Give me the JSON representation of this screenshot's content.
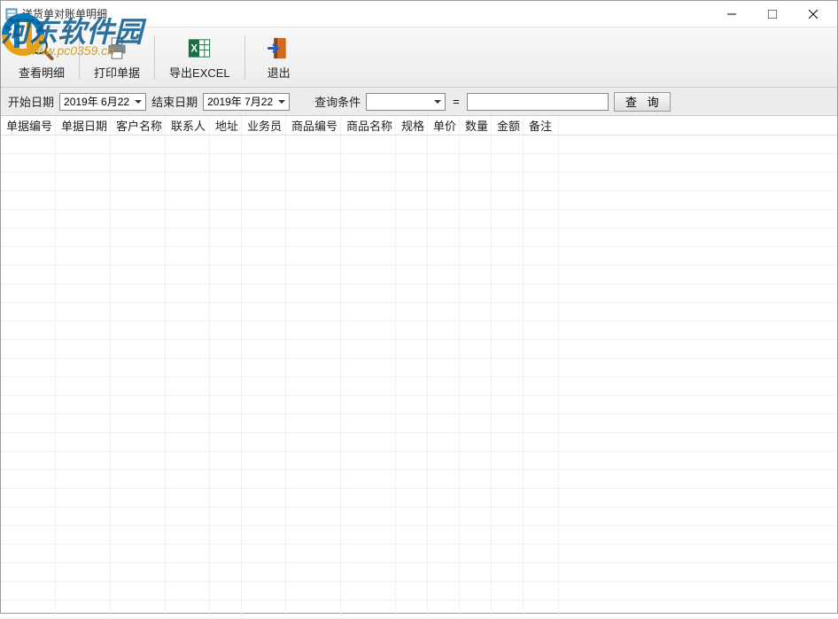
{
  "window": {
    "title": "送货单对账单明细"
  },
  "watermark": {
    "text": "河东软件园",
    "url": "www.pc0359.cn"
  },
  "toolbar": {
    "view_detail": "查看明细",
    "print_doc": "打印单据",
    "export_excel": "导出EXCEL",
    "exit": "退出"
  },
  "filter": {
    "start_date_label": "开始日期",
    "start_date_value": "2019年 6月22",
    "end_date_label": "结束日期",
    "end_date_value": "2019年 7月22",
    "query_condition_label": "查询条件",
    "query_condition_value": "",
    "equals": "=",
    "query_value": "",
    "query_button": "查 询"
  },
  "columns": {
    "c0": "单据编号",
    "c1": "单据日期",
    "c2": "客户名称",
    "c3": "联系人",
    "c4": "地址",
    "c5": "业务员",
    "c6": "商品编号",
    "c7": "商品名称",
    "c8": "规格",
    "c9": "单价",
    "c10": "数量",
    "c11": "金额",
    "c12": "备注"
  }
}
